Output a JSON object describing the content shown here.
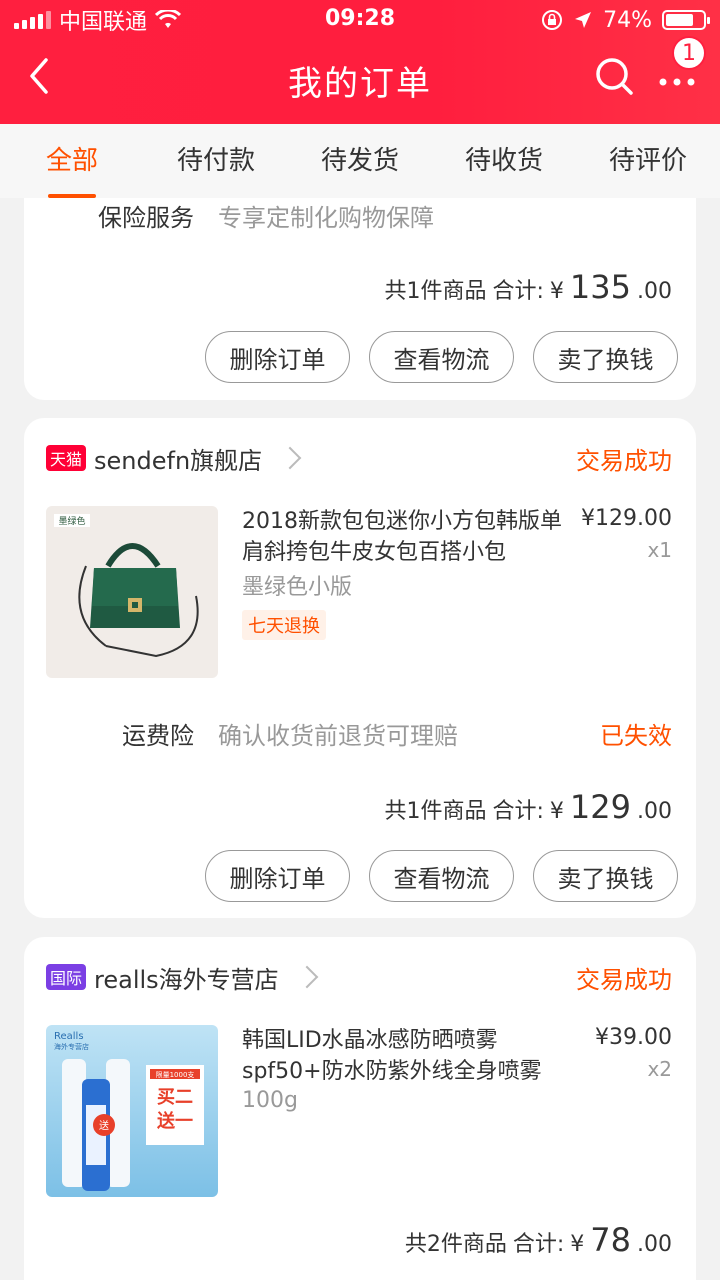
{
  "status_bar": {
    "carrier": "中国联通",
    "time": "09:28",
    "battery": "74%",
    "battery_level": 0.74
  },
  "nav": {
    "title": "我的订单",
    "badge_count": "1"
  },
  "tabs": [
    {
      "label": "全部",
      "active": true
    },
    {
      "label": "待付款"
    },
    {
      "label": "待发货"
    },
    {
      "label": "待收货"
    },
    {
      "label": "待评价"
    }
  ],
  "order_prev": {
    "insurance_label": "保险服务",
    "insurance_desc": "专享定制化购物保障",
    "summary_count": "共1件商品",
    "summary_label": "合计:",
    "total_yen": "¥",
    "total_int": "135",
    "total_dec": ".00",
    "actions": [
      "删除订单",
      "查看物流",
      "卖了换钱"
    ]
  },
  "order_1": {
    "shop_tag": "天猫",
    "shop_name": "sendefn旗舰店",
    "status": "交易成功",
    "thumb_text": "墨绿色",
    "product_title": "2018新款包包迷你小方包韩版单肩斜挎包牛皮女包百搭小包",
    "sku": "墨绿色小版",
    "service_tag": "七天退换",
    "price": "¥129.00",
    "qty": "x1",
    "insurance_label": "运费险",
    "insurance_desc": "确认收货前退货可理赔",
    "insurance_status": "已失效",
    "summary_count": "共1件商品",
    "summary_label": "合计:",
    "total_yen": "¥",
    "total_int": "129",
    "total_dec": ".00",
    "actions": [
      "删除订单",
      "查看物流",
      "卖了换钱"
    ]
  },
  "order_2": {
    "shop_tag": "国际",
    "shop_name": "realls海外专营店",
    "status": "交易成功",
    "thumb_brand": "Realls",
    "thumb_sub": "海外专营店",
    "thumb_limit": "限量1000支",
    "thumb_promo1": "买二",
    "thumb_promo2": "送一",
    "thumb_send": "送",
    "product_title": "韩国LID水晶冰感防晒喷雾spf50+防水防紫外线全身喷雾",
    "sku": "100g",
    "price": "¥39.00",
    "qty": "x2",
    "summary_count": "共2件商品",
    "summary_label": "合计:",
    "total_yen": "¥",
    "total_int": "78",
    "total_dec": ".00"
  },
  "colors": {
    "header_red": "#ff1f3f",
    "accent_orange": "#ff5000",
    "tmall_red": "#ff0036",
    "global_purple": "#7b3fe4"
  }
}
